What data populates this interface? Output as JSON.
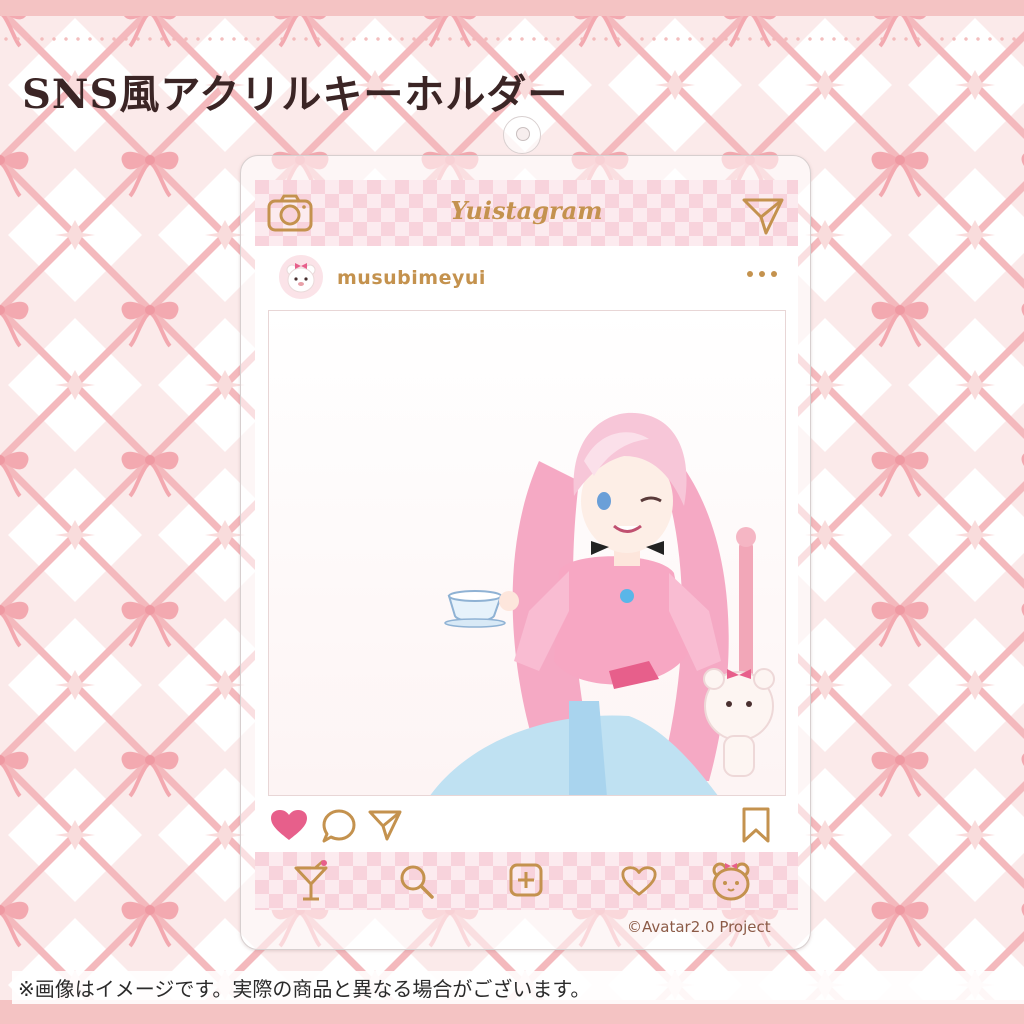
{
  "headline": "SNS風アクリルキーホルダー",
  "note": "※画像はイメージです。実際の商品と異なる場合がございます。",
  "colors": {
    "accent": "#c4924e",
    "heart": "#e75f8b",
    "background": "#fbeeee",
    "ribbon": "#f3b1b6"
  },
  "app": {
    "title": "Yuistagram",
    "header_icons": [
      "camera-icon",
      "send-icon"
    ],
    "username": "musubimeyui",
    "avatar": "bear-avatar",
    "action_icons": [
      "heart-icon-filled",
      "comment-icon",
      "send-icon",
      "bookmark-icon"
    ],
    "nav_icons": [
      "cocktail-icon",
      "search-icon",
      "plus-square-icon",
      "heart-icon",
      "bear-icon"
    ],
    "photo": "anime-girl-with-teacup"
  },
  "copyright": "©Avatar2.0 Project"
}
